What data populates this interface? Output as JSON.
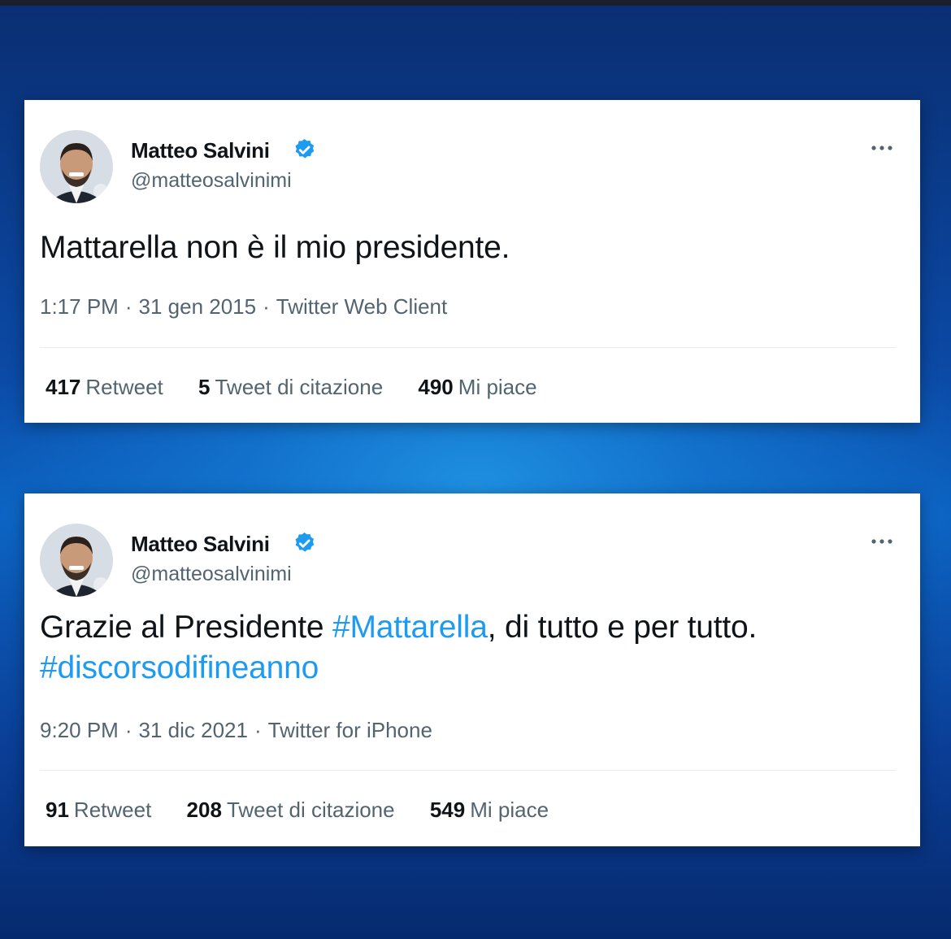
{
  "colors": {
    "text_primary": "#0f1419",
    "text_secondary": "#536471",
    "link": "#1d9bf0",
    "verified": "#1d9bf0"
  },
  "tweets": [
    {
      "author": {
        "name": "Matteo Salvini",
        "handle": "@matteosalvinimi",
        "verified": true,
        "avatar_icon": "profile-photo"
      },
      "text_parts": [
        {
          "text": "Mattarella non è il mio presidente.",
          "type": "plain"
        }
      ],
      "time": "1:17 PM",
      "date": "31 gen 2015",
      "source": "Twitter Web Client",
      "stats": [
        {
          "count": "417",
          "label": "Retweet"
        },
        {
          "count": "5",
          "label": "Tweet di citazione"
        },
        {
          "count": "490",
          "label": "Mi piace"
        }
      ]
    },
    {
      "author": {
        "name": "Matteo Salvini",
        "handle": "@matteosalvinimi",
        "verified": true,
        "avatar_icon": "profile-photo"
      },
      "text_parts": [
        {
          "text": "Grazie al Presidente ",
          "type": "plain"
        },
        {
          "text": "#Mattarella",
          "type": "hashtag"
        },
        {
          "text": ", di tutto e per tutto.",
          "type": "plain"
        },
        {
          "text": "#discorsodifineanno",
          "type": "hashtag"
        }
      ],
      "time": "9:20 PM",
      "date": "31 dic 2021",
      "source": "Twitter for iPhone",
      "stats": [
        {
          "count": "91",
          "label": "Retweet"
        },
        {
          "count": "208",
          "label": "Tweet di citazione"
        },
        {
          "count": "549",
          "label": "Mi piace"
        }
      ]
    }
  ],
  "meta_separator": "·",
  "more_icon": "more-horizontal-icon"
}
